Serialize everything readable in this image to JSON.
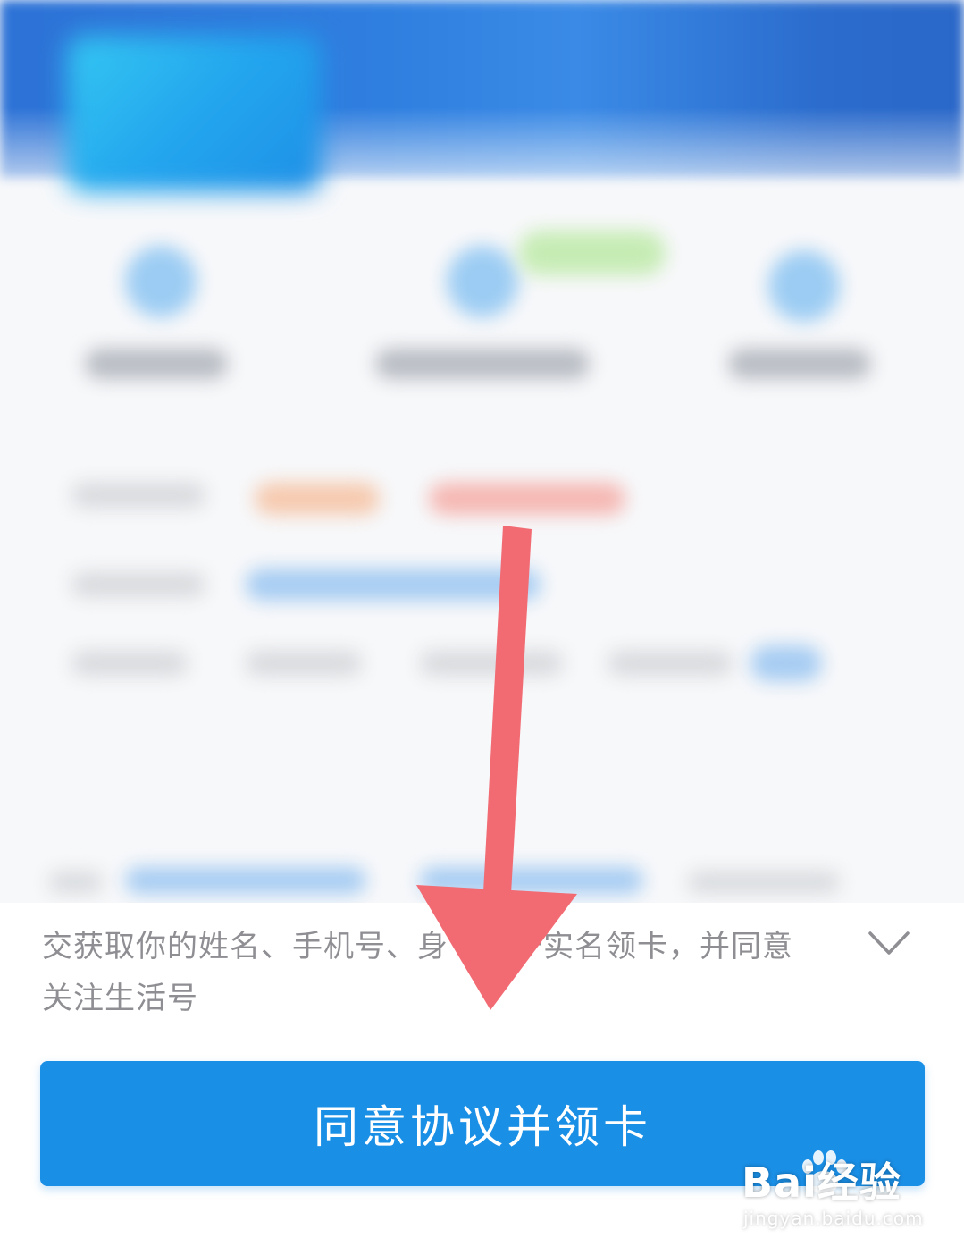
{
  "agreement": {
    "line1": "交获取你的姓名、手机号、身",
    "line1_end": "用于实名领卡，并同意",
    "line2": "关注生活号"
  },
  "agree_button": {
    "label": "同意协议并领卡"
  },
  "watermark": {
    "brand": "Bai经验",
    "site": "jingyan.baidu.com"
  },
  "colors": {
    "button": "#1a8fe6",
    "arrow": "#f26b73",
    "header": "#2d72d6"
  },
  "icons": {
    "chevron": "chevron-down-icon",
    "arrow": "down-arrow-annotation",
    "paw": "baidu-paw-icon"
  }
}
